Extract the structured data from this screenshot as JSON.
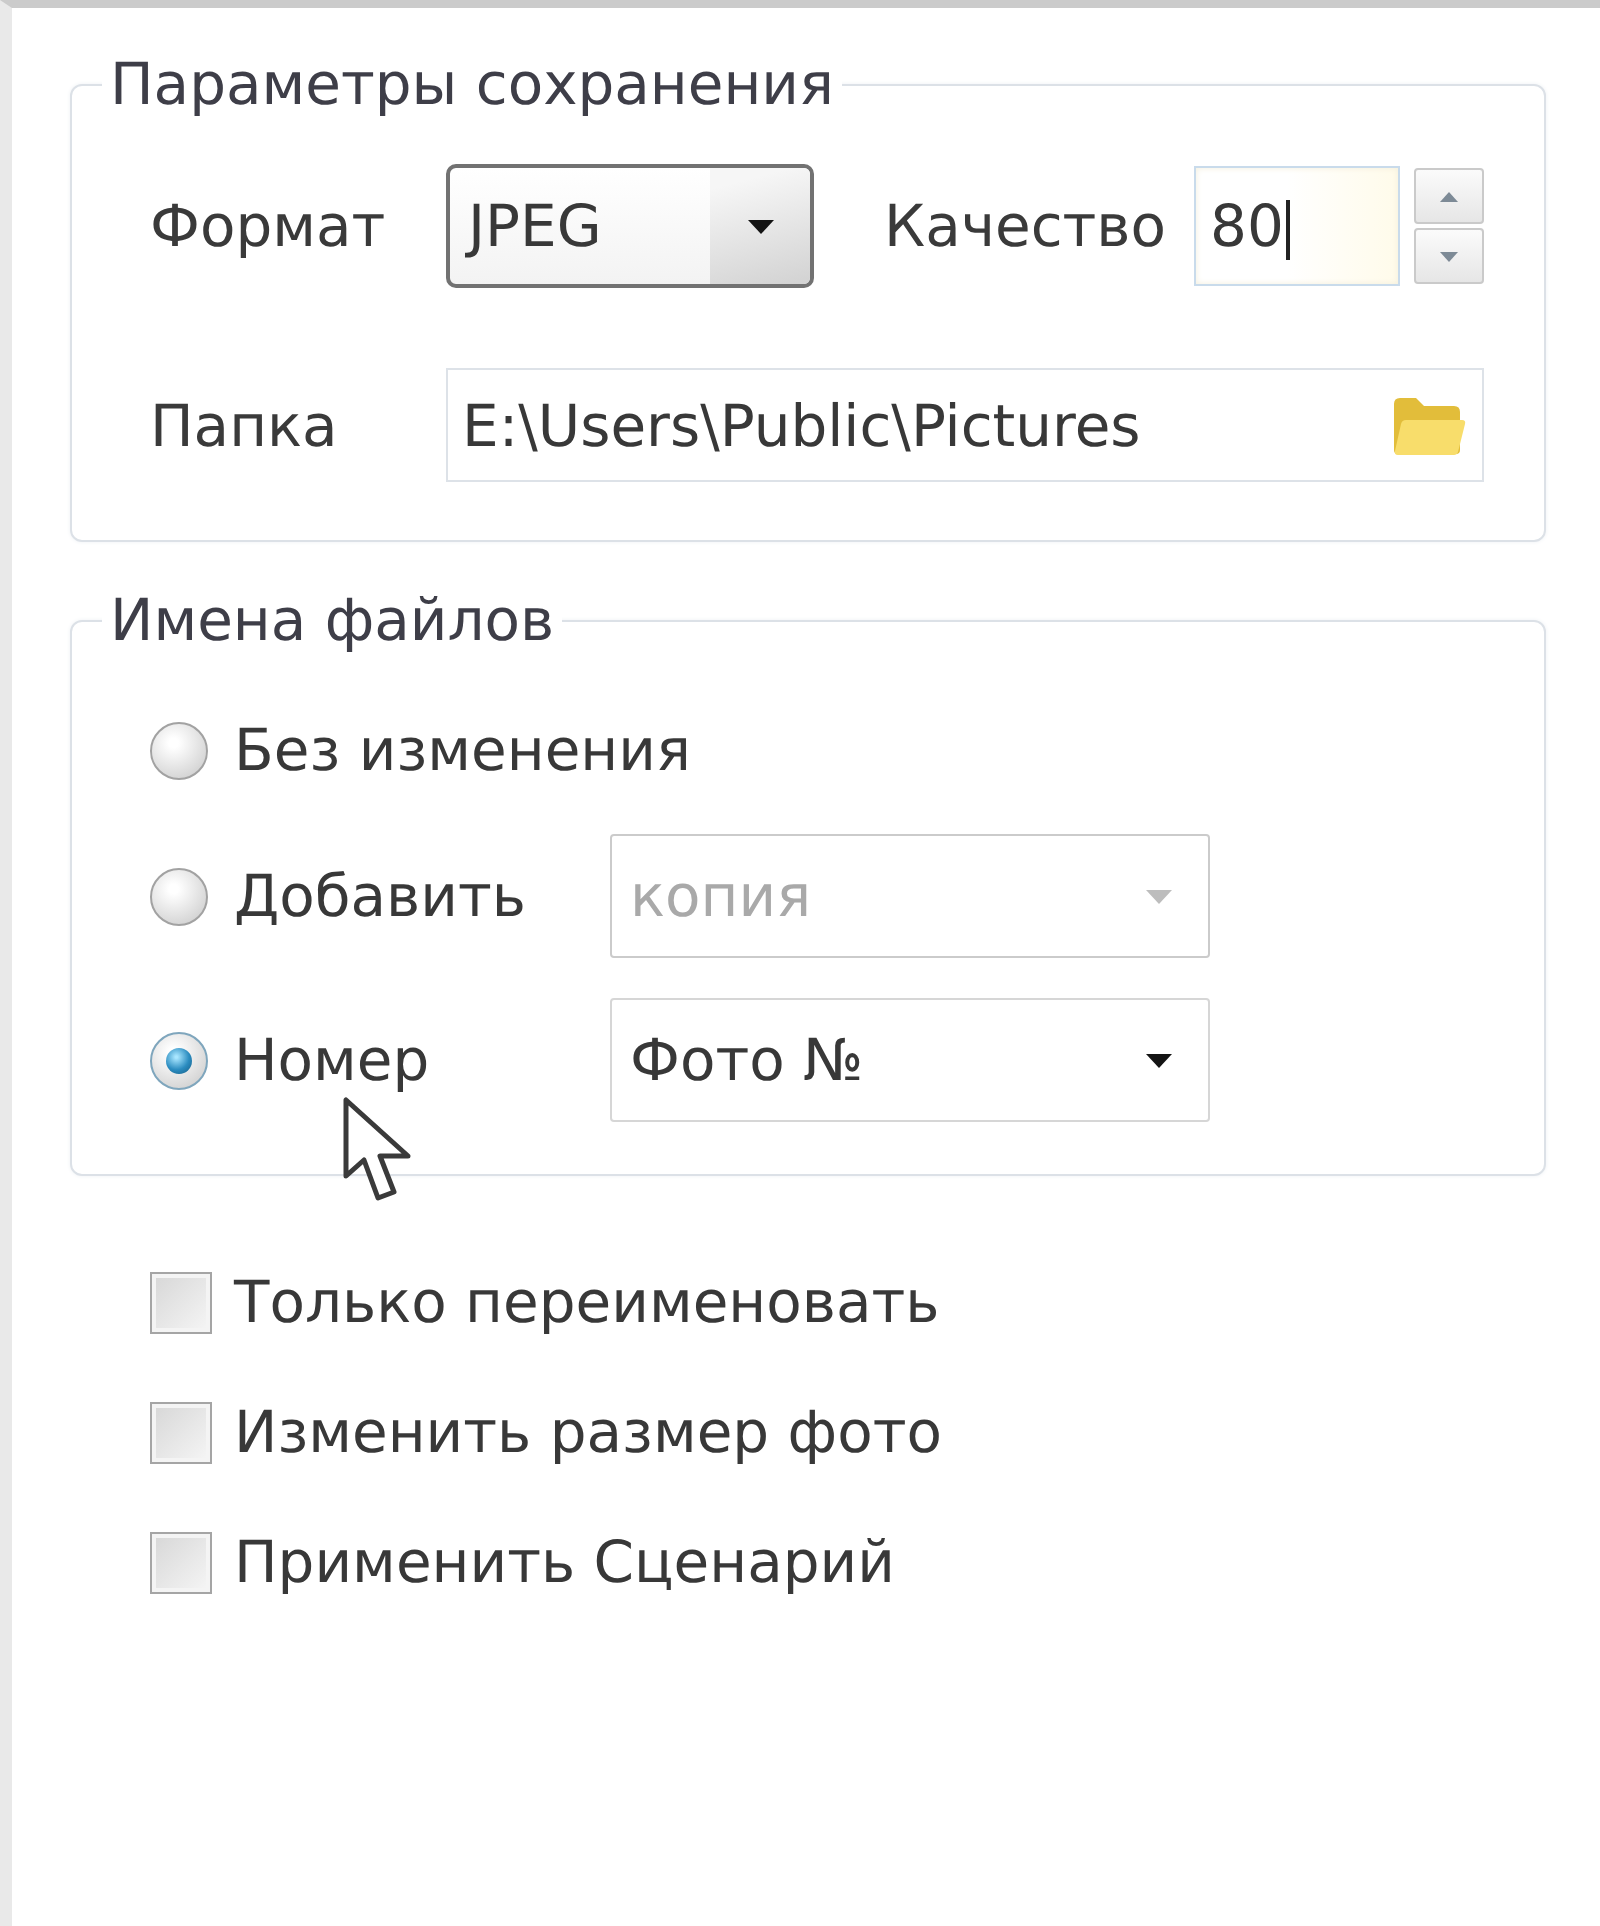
{
  "save_settings": {
    "title": "Параметры сохранения",
    "format": {
      "label": "Формат",
      "value": "JPEG"
    },
    "quality": {
      "label": "Качество",
      "value": "80",
      "focused": true
    },
    "folder": {
      "label": "Папка",
      "value": "E:\\Users\\Public\\Pictures"
    }
  },
  "file_names": {
    "title": "Имена файлов",
    "options": [
      {
        "label": "Без изменения",
        "selected": false
      },
      {
        "label": "Добавить",
        "selected": false,
        "dropdown": {
          "value": "копия",
          "disabled": true
        }
      },
      {
        "label": "Номер",
        "selected": true,
        "dropdown": {
          "value": "Фото №",
          "disabled": false
        }
      }
    ]
  },
  "options": [
    {
      "label": "Только переименовать",
      "checked": false
    },
    {
      "label": "Изменить размер фото",
      "checked": false
    },
    {
      "label": "Применить Сценарий",
      "checked": false
    }
  ]
}
